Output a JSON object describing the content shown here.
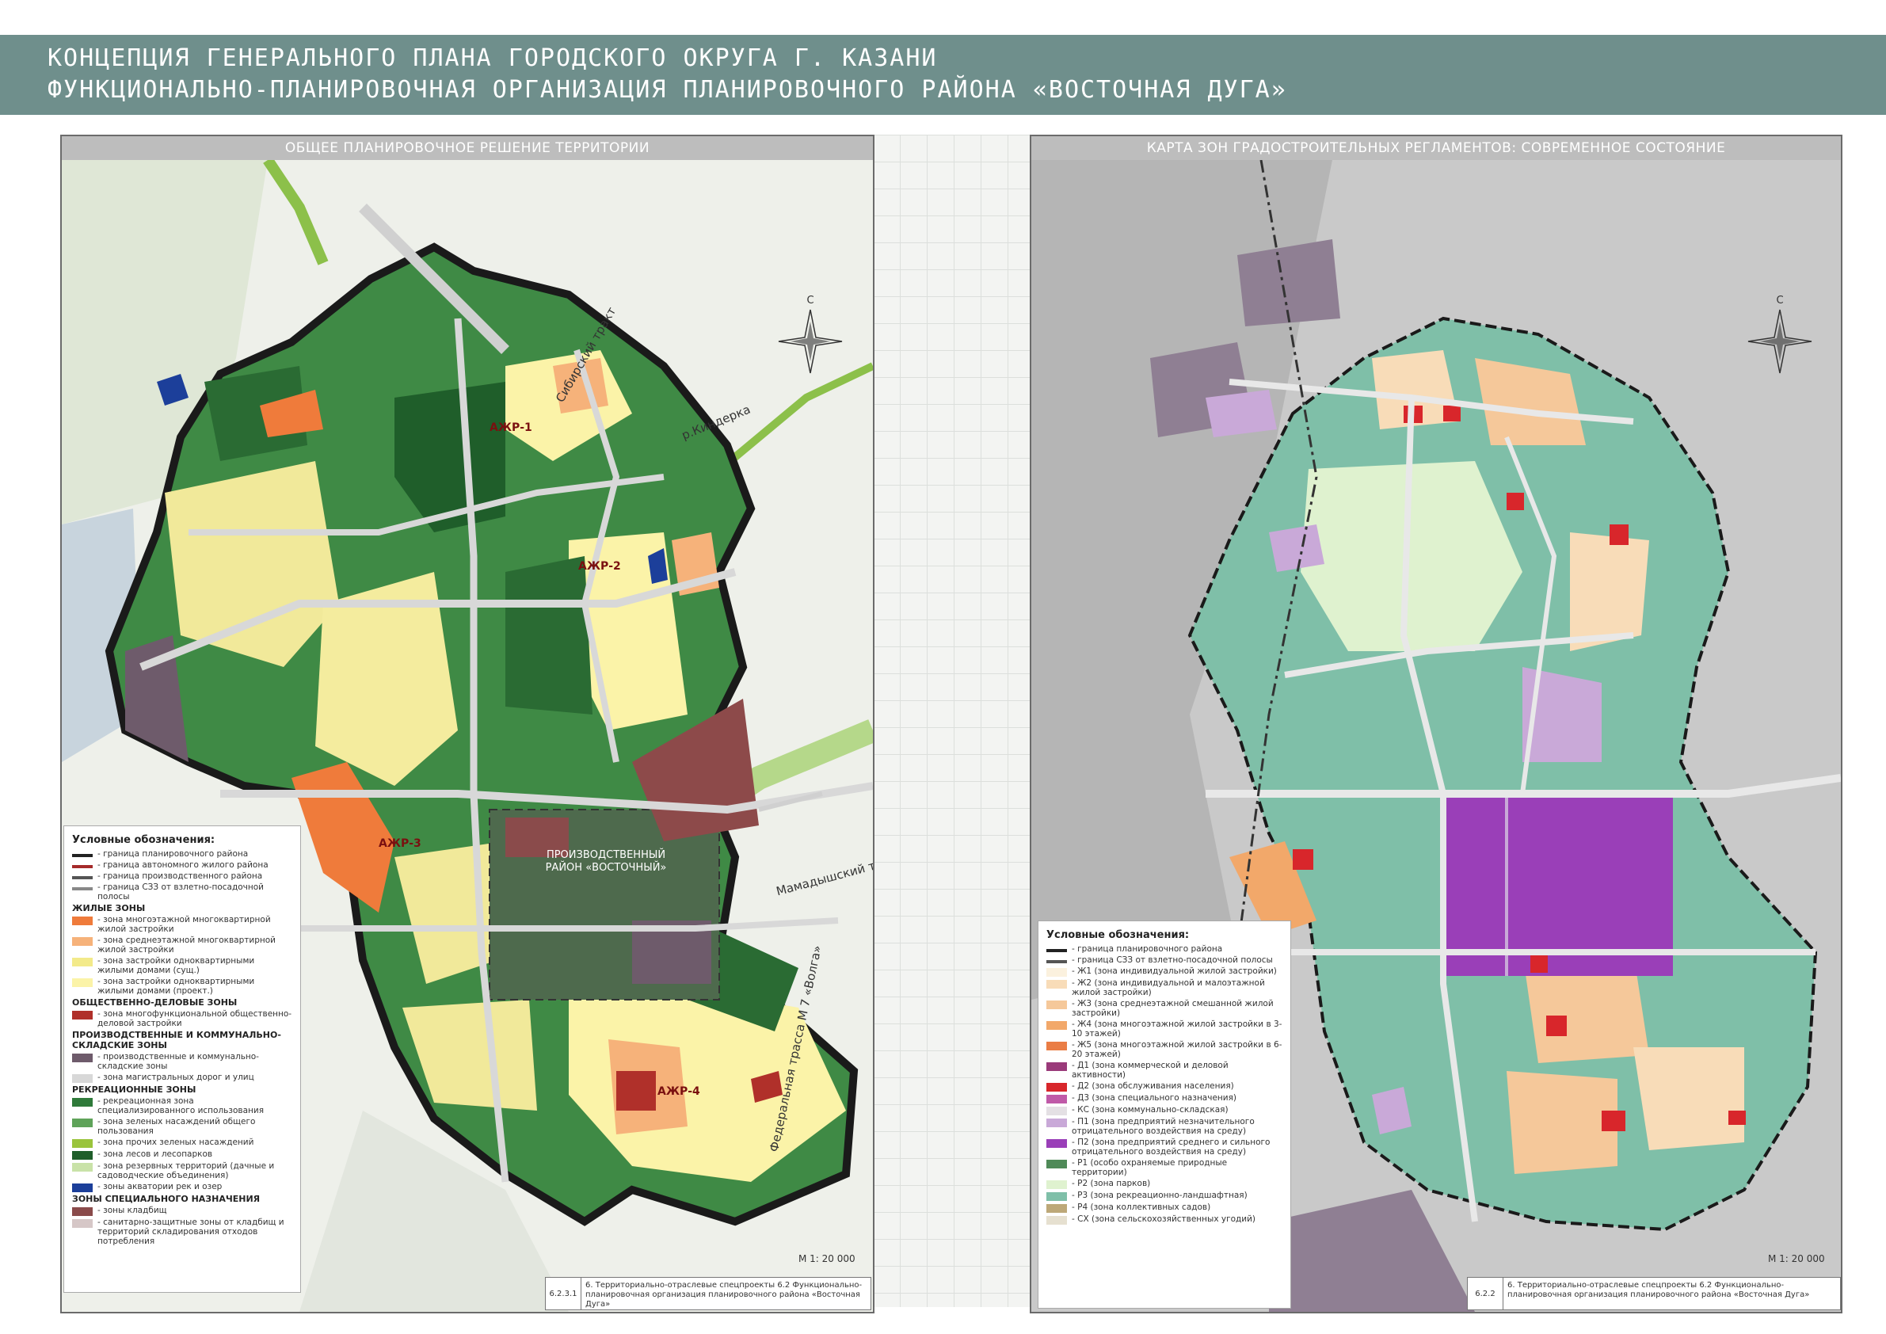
{
  "header": {
    "line1": "КОНЦЕПЦИЯ ГЕНЕРАЛЬНОГО ПЛАНА ГОРОДСКОГО ОКРУГА Г. КАЗАНИ",
    "line2": "ФУНКЦИОНАЛЬНО-ПЛАНИРОВОЧНАЯ ОРГАНИЗАЦИЯ ПЛАНИРОВОЧНОГО РАЙОНА «ВОСТОЧНАЯ ДУГА»"
  },
  "left": {
    "title": "ОБЩЕЕ ПЛАНИРОВОЧНОЕ РЕШЕНИЕ ТЕРРИТОРИИ",
    "compass_n": "С",
    "roads": {
      "siberian": "Сибирский тракт",
      "river": "р.Киндерка",
      "mamadysh": "Мамадышский тракт",
      "federal": "Федеральная трасса М 7 «Волга»"
    },
    "zones": {
      "ajr1": "АЖР-1",
      "ajr2": "АЖР-2",
      "ajr3": "АЖР-3",
      "ajr4": "АЖР-4"
    },
    "plant": "ПРОИЗВОДСТВЕННЫЙ РАЙОН «ВОСТОЧНЫЙ»",
    "legend": {
      "title": "Условные обозначения:",
      "rows": [
        {
          "k": "line",
          "c": "#222222",
          "t": "- граница планировочного района"
        },
        {
          "k": "line",
          "c": "#a52a2a",
          "t": "- граница автономного жилого района"
        },
        {
          "k": "line",
          "c": "#555555",
          "t": "- граница производственного района"
        },
        {
          "k": "line",
          "c": "#888888",
          "t": "- граница СЗЗ от взлетно-посадочной полосы"
        },
        {
          "k": "head",
          "t": "ЖИЛЫЕ ЗОНЫ"
        },
        {
          "k": "sw",
          "c": "#ef7b3b",
          "t": "- зона многоэтажной многоквартирной жилой застройки"
        },
        {
          "k": "sw",
          "c": "#f6b27a",
          "t": "- зона среднеэтажной многоквартирной жилой застройки"
        },
        {
          "k": "sw",
          "c": "#f3ea8a",
          "t": "- зона застройки одноквартирными жилыми домами (сущ.)"
        },
        {
          "k": "sw",
          "c": "#fbf3a8",
          "t": "- зона застройки одноквартирными жилыми домами (проект.)"
        },
        {
          "k": "head",
          "t": "ОБЩЕСТВЕННО-ДЕЛОВЫЕ ЗОНЫ"
        },
        {
          "k": "sw",
          "c": "#b0302a",
          "t": "- зона многофункциональной общественно-деловой застройки"
        },
        {
          "k": "head",
          "t": "ПРОИЗВОДСТВЕННЫЕ И КОММУНАЛЬНО-СКЛАДСКИЕ ЗОНЫ"
        },
        {
          "k": "sw",
          "c": "#6e5b6b",
          "t": "- производственные и коммунально-складские зоны"
        },
        {
          "k": "sw",
          "c": "#d8d8d8",
          "t": "- зона магистральных дорог и улиц"
        },
        {
          "k": "head",
          "t": "РЕКРЕАЦИОННЫЕ ЗОНЫ"
        },
        {
          "k": "sw",
          "c": "#2f7a3a",
          "t": "- рекреационная зона специализированного использования"
        },
        {
          "k": "sw",
          "c": "#5fa35a",
          "t": "- зона зеленых насаждений общего пользования"
        },
        {
          "k": "sw",
          "c": "#9ac43c",
          "t": "- зона прочих зеленых насаждений"
        },
        {
          "k": "sw",
          "c": "#1f5e2a",
          "t": "- зона лесов и лесопарков"
        },
        {
          "k": "sw",
          "c": "#c9e2a8",
          "t": "- зона резервных территорий (дачные и садоводческие объединения)"
        },
        {
          "k": "sw",
          "c": "#1c3f9a",
          "t": "- зоны акватории рек и озер"
        },
        {
          "k": "head",
          "t": "ЗОНЫ СПЕЦИАЛЬНОГО НАЗНАЧЕНИЯ"
        },
        {
          "k": "sw",
          "c": "#8a4b4b",
          "t": "- зоны кладбищ"
        },
        {
          "k": "sw",
          "c": "#d6c7c7",
          "t": "- санитарно-защитные зоны от кладбищ и территорий складирования отходов потребления"
        }
      ]
    },
    "scale": "М 1: 20 000",
    "stamp_num": "6.2.3.1",
    "stamp_txt": "6. Территориально-отраслевые спецпроекты 6.2 Функционально-планировочная организация планировочного района «Восточная Дуга»"
  },
  "right": {
    "title": "КАРТА ЗОН ГРАДОСТРОИТЕЛЬНЫХ РЕГЛАМЕНТОВ: СОВРЕМЕННОЕ СОСТОЯНИЕ",
    "compass_n": "С",
    "legend": {
      "title": "Условные обозначения:",
      "rows": [
        {
          "k": "line",
          "c": "#222222",
          "t": "- граница планировочного района"
        },
        {
          "k": "line",
          "c": "#555555",
          "t": "- граница СЗЗ от взлетно-посадочной полосы"
        },
        {
          "k": "sw",
          "c": "#fbf1de",
          "t": "- Ж1 (зона индивидуальной жилой застройки)"
        },
        {
          "k": "sw",
          "c": "#f8dcb8",
          "t": "- Ж2 (зона индивидуальной и малоэтажной жилой застройки)"
        },
        {
          "k": "sw",
          "c": "#f5c89a",
          "t": "- Ж3 (зона среднеэтажной смешанной жилой застройки)"
        },
        {
          "k": "sw",
          "c": "#f2a86a",
          "t": "- Ж4 (зона многоэтажной жилой застройки в 3-10 этажей)"
        },
        {
          "k": "sw",
          "c": "#ea7d45",
          "t": "- Ж5 (зона многоэтажной жилой застройки в 6-20 этажей)"
        },
        {
          "k": "sw",
          "c": "#9a3a7a",
          "t": "- Д1 (зона коммерческой и деловой активности)"
        },
        {
          "k": "sw",
          "c": "#d8262b",
          "t": "- Д2 (зона обслуживания населения)"
        },
        {
          "k": "sw",
          "c": "#c05aa8",
          "t": "- Д3 (зона специального назначения)"
        },
        {
          "k": "sw",
          "c": "#e4e0e4",
          "t": "- КС (зона коммунально-складская)"
        },
        {
          "k": "sw",
          "c": "#c9a9d8",
          "t": "- П1 (зона предприятий незначительного отрицательного воздействия на среду)"
        },
        {
          "k": "sw",
          "c": "#9a3fb8",
          "t": "- П2 (зона предприятий среднего и сильного отрицательного воздействия на среду)"
        },
        {
          "k": "sw",
          "c": "#4f8a58",
          "t": "- Р1 (особо охраняемые природные территории)"
        },
        {
          "k": "sw",
          "c": "#dff2cf",
          "t": "- Р2 (зона парков)"
        },
        {
          "k": "sw",
          "c": "#7fbfa8",
          "t": "- Р3 (зона рекреационно-ландшафтная)"
        },
        {
          "k": "sw",
          "c": "#bda878",
          "t": "- Р4 (зона коллективных садов)"
        },
        {
          "k": "sw",
          "c": "#e6e0d0",
          "t": "- СХ (зона сельскохозяйственных угодий)"
        }
      ]
    },
    "scale": "М 1: 20 000",
    "stamp_num": "6.2.2",
    "stamp_txt": "6. Территориально-отраслевые спецпроекты 6.2 Функционально-планировочная организация планировочного района «Восточная Дуга»"
  }
}
